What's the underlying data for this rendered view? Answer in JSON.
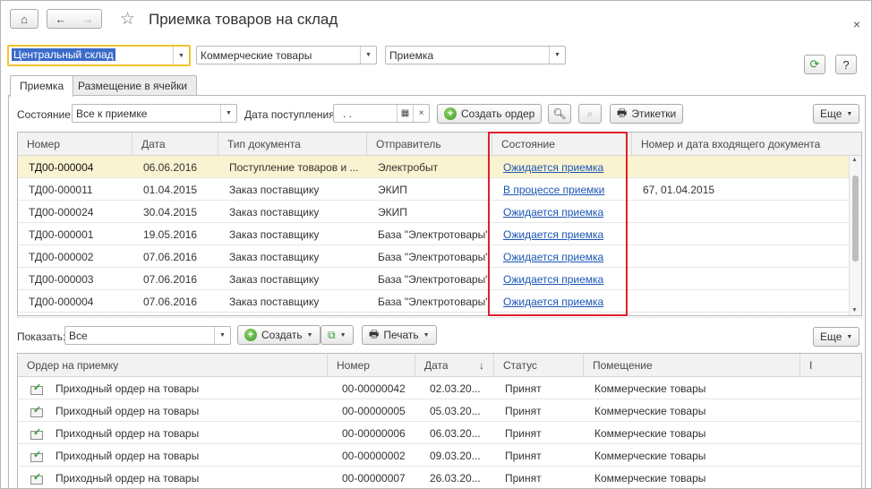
{
  "window": {
    "title": "Приемка товаров на склад",
    "close_glyph": "×"
  },
  "filters": {
    "warehouse": "Центральный склад",
    "premises": "Коммерческие товары",
    "operation": "Приемка"
  },
  "tabs": [
    {
      "label": "Приемка"
    },
    {
      "label": "Размещение в ячейки"
    }
  ],
  "toolbar": {
    "state_label": "Состояние:",
    "state_value": "Все к приемке",
    "date_label": "Дата поступления:",
    "date_value": ".  .",
    "create_order": "Создать ордер",
    "labels": "Этикетки",
    "more": "Еще"
  },
  "upper_grid": {
    "columns": [
      "Номер",
      "Дата",
      "Тип документа",
      "Отправитель",
      "Состояние",
      "Номер и дата входящего документа"
    ],
    "rows": [
      {
        "num": "ТД00-000004",
        "date": "06.06.2016",
        "type": "Поступление товаров и ...",
        "sender": "Электробыт",
        "state": "Ожидается приемка",
        "incoming": ""
      },
      {
        "num": "ТД00-000011",
        "date": "01.04.2015",
        "type": "Заказ поставщику",
        "sender": "ЭКИП",
        "state": "В процессе приемки",
        "incoming": "67, 01.04.2015"
      },
      {
        "num": "ТД00-000024",
        "date": "30.04.2015",
        "type": "Заказ поставщику",
        "sender": "ЭКИП",
        "state": "Ожидается приемка",
        "incoming": ""
      },
      {
        "num": "ТД00-000001",
        "date": "19.05.2016",
        "type": "Заказ поставщику",
        "sender": "База \"Электротовары\"",
        "state": "Ожидается приемка",
        "incoming": ""
      },
      {
        "num": "ТД00-000002",
        "date": "07.06.2016",
        "type": "Заказ поставщику",
        "sender": "База \"Электротовары\"",
        "state": "Ожидается приемка",
        "incoming": ""
      },
      {
        "num": "ТД00-000003",
        "date": "07.06.2016",
        "type": "Заказ поставщику",
        "sender": "База \"Электротовары\"",
        "state": "Ожидается приемка",
        "incoming": ""
      },
      {
        "num": "ТД00-000004",
        "date": "07.06.2016",
        "type": "Заказ поставщику",
        "sender": "База \"Электротовары\"",
        "state": "Ожидается приемка",
        "incoming": ""
      }
    ]
  },
  "toolbar2": {
    "show_label": "Показать:",
    "show_value": "Все",
    "create": "Создать",
    "print": "Печать",
    "more": "Еще"
  },
  "lower_grid": {
    "columns": [
      "Ордер на приемку",
      "Номер",
      "Дата",
      "Статус",
      "Помещение",
      "I"
    ],
    "sort_arrow": "↓",
    "rows": [
      {
        "order": "Приходный ордер на товары",
        "num": "00-00000042",
        "date": "02.03.20...",
        "status": "Принят",
        "room": "Коммерческие товары"
      },
      {
        "order": "Приходный ордер на товары",
        "num": "00-00000005",
        "date": "05.03.20...",
        "status": "Принят",
        "room": "Коммерческие товары"
      },
      {
        "order": "Приходный ордер на товары",
        "num": "00-00000006",
        "date": "06.03.20...",
        "status": "Принят",
        "room": "Коммерческие товары"
      },
      {
        "order": "Приходный ордер на товары",
        "num": "00-00000002",
        "date": "09.03.20...",
        "status": "Принят",
        "room": "Коммерческие товары"
      },
      {
        "order": "Приходный ордер на товары",
        "num": "00-00000007",
        "date": "26.03.20...",
        "status": "Принят",
        "room": "Коммерческие товары"
      }
    ]
  }
}
